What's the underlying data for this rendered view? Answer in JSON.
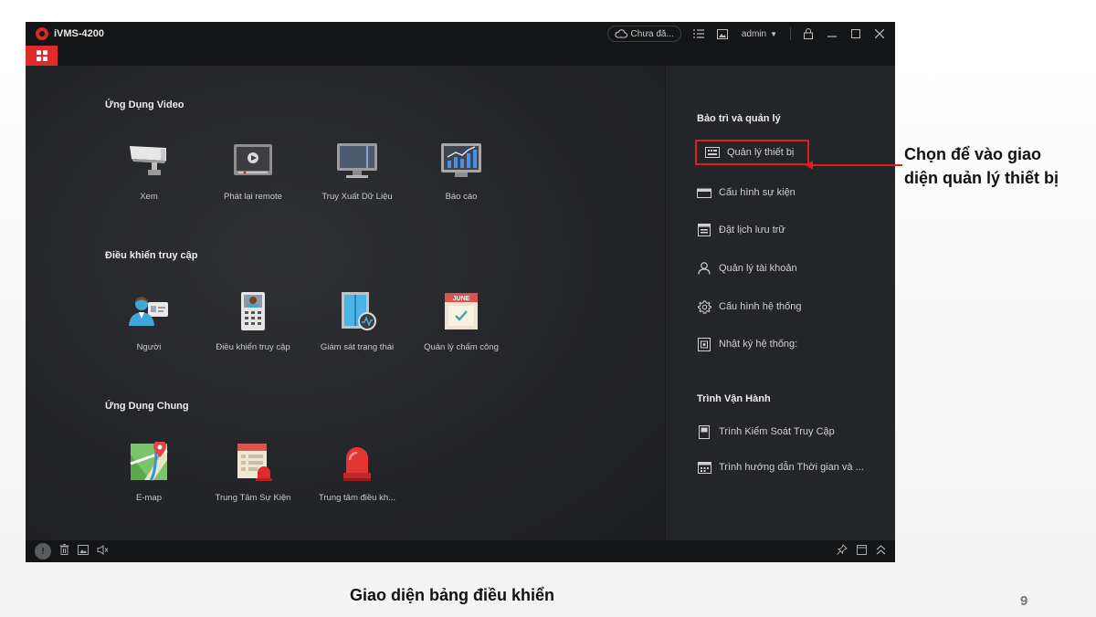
{
  "app": {
    "title": "iVMS-4200",
    "cloud_status": "Chưa đă...",
    "user": "admin"
  },
  "main": {
    "sections": [
      {
        "title": "Ứng Dụng Video",
        "items": [
          {
            "label": "Xem",
            "icon": "camera-icon"
          },
          {
            "label": "Phát lại remote",
            "icon": "remote-playback-icon"
          },
          {
            "label": "Truy Xuất Dữ Liệu",
            "icon": "monitor-icon"
          },
          {
            "label": "Báo cáo",
            "icon": "report-chart-icon"
          }
        ]
      },
      {
        "title": "Điều khiển truy cập",
        "items": [
          {
            "label": "Người",
            "icon": "person-card-icon"
          },
          {
            "label": "Điều khiển truy cập",
            "icon": "access-control-icon"
          },
          {
            "label": "Giám sát trạng thái",
            "icon": "door-status-icon"
          },
          {
            "label": "Quản lý chấm công",
            "icon": "calendar-icon"
          }
        ]
      },
      {
        "title": "Ứng Dụng Chung",
        "items": [
          {
            "label": "E-map",
            "icon": "map-pin-icon"
          },
          {
            "label": "Trung Tâm Sự Kiện",
            "icon": "event-center-icon"
          },
          {
            "label": "Trung tâm điều kh...",
            "icon": "alarm-light-icon"
          }
        ]
      }
    ],
    "calendar_month": "JUNE"
  },
  "sidebar": {
    "groups": [
      {
        "title": "Bảo trì và quản lý",
        "items": [
          {
            "label": "Quản lý thiết bị",
            "icon": "device-icon",
            "selected": true
          },
          {
            "label": "Cấu hình sự kiện",
            "icon": "event-config-icon"
          },
          {
            "label": "Đặt lịch lưu trữ",
            "icon": "storage-schedule-icon"
          },
          {
            "label": "Quản lý tài khoản",
            "icon": "user-icon"
          },
          {
            "label": "Cấu hình hệ thống",
            "icon": "gear-icon"
          },
          {
            "label": "Nhật ký hệ thống:",
            "icon": "log-icon"
          }
        ]
      },
      {
        "title": "Trình Vận Hành",
        "items": [
          {
            "label": "Trình Kiểm Soát Truy Cập",
            "icon": "access-tool-icon"
          },
          {
            "label": "Trình hướng dẫn Thời gian và ...",
            "icon": "time-wizard-icon"
          }
        ]
      }
    ]
  },
  "annotation": {
    "callout_line1": "Chọn để vào giao",
    "callout_line2": "diện quản lý thiết bị",
    "caption": "Giao diện bảng điều khiển",
    "page_number": "9"
  },
  "colors": {
    "accent": "#e02b2b",
    "highlight": "#e21c1c",
    "bg": "#1b1c1e"
  }
}
